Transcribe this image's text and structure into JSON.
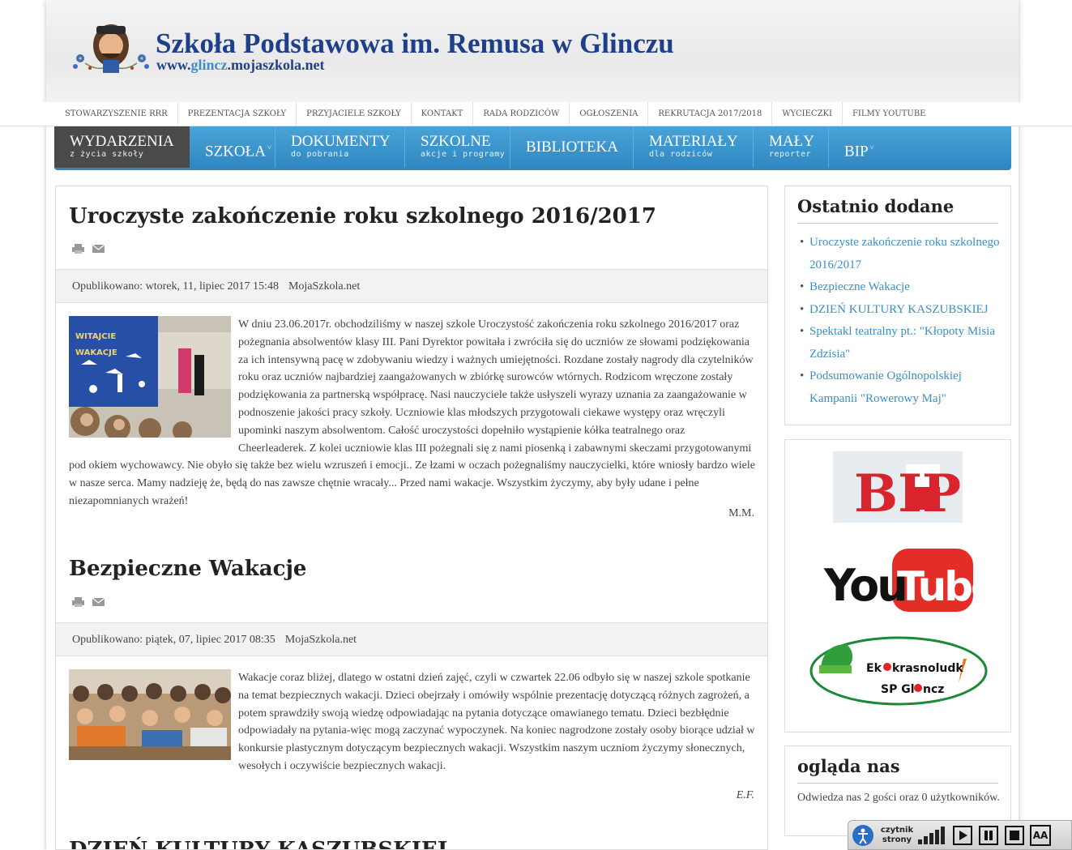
{
  "header": {
    "title": "Szkoła Podstawowa im. Remusa w Glinczu",
    "url_pre": "www.",
    "url_accent": "glincz",
    "url_post": ".mojaszkola.net"
  },
  "top_links": [
    "STOWARZYSZENIE RRR",
    "PREZENTACJA SZKOŁY",
    "PRZYJACIELE SZKOŁY",
    "KONTAKT",
    "RADA RODZICÓW",
    "OGŁOSZENIA",
    "REKRUTACJA 2017/2018",
    "WYCIECZKI",
    "FILMY YOUTUBE"
  ],
  "nav": {
    "wydarzenia": {
      "label": "WYDARZENIA",
      "sub": "z życia szkoły"
    },
    "szkola": {
      "label": "SZKOŁA"
    },
    "dokumenty": {
      "label": "DOKUMENTY",
      "sub": "do pobrania"
    },
    "szkolne": {
      "label": "SZKOLNE",
      "sub": "akcje i programy"
    },
    "biblioteka": {
      "label": "BIBLIOTEKA"
    },
    "materialy": {
      "label": "MATERIAŁY",
      "sub": "dla rodziców"
    },
    "maly": {
      "label": "MAŁY",
      "sub": "reporter"
    },
    "bip": {
      "label": "BIP"
    }
  },
  "articles": [
    {
      "title": "Uroczyste zakończenie roku szkolnego 2016/2017",
      "published": "Opublikowano: wtorek, 11, lipiec 2017 15:48",
      "author": "MojaSzkola.net",
      "body": "W dniu 23.06.2017r. obchodziliśmy w naszej szkole Uroczystość zakończenia roku szkolnego 2016/2017 oraz pożegnania absolwentów klasy III. Pani Dyrektor powitała i zwróciła się do uczniów ze słowami podziękowania za ich intensywną pacę w zdobywaniu wiedzy i ważnych umiejętności. Rozdane zostały nagrody dla czytelników roku oraz uczniów najbardziej zaangażowanych w zbiórkę surowców wtórnych. Rodzicom wręczone zostały podziękowania za partnerską współpracę. Nasi nauczyciele także usłyszeli wyrazy uznania za zaangażowanie w podnoszenie jakości pracy szkoły. Uczniowie klas młodszych przygotowali ciekawe występy oraz wręczyli upominki naszym absolwentom. Całość uroczystości dopełniło wystąpienie kółka teatralnego oraz Cheerleaderek. Z kolei uczniowie klas III pożegnali się z nami piosenką i zabawnymi skeczami przygotowanymi pod okiem wychowawcy. Nie obyło się także bez wielu wzruszeń i emocji.. Ze łzami w oczach pożegnaliśmy nauczycielki, które wniosły bardzo wiele w nasze serca. Mamy nadzieję że, będą do nas zawsze chętnie wracały...  Przed nami wakacje. Wszystkim życzymy, aby były udane i pełne niezapomnianych wrażeń!",
      "signature": "M.M."
    },
    {
      "title": "Bezpieczne Wakacje",
      "published": "Opublikowano: piątek, 07, lipiec 2017 08:35",
      "author": "MojaSzkola.net",
      "body": "Wakacje coraz bliżej, dlatego w ostatni dzień zajęć, czyli w czwartek 22.06 odbyło się w naszej szkole spotkanie na temat bezpiecznych wakacji. Dzieci obejrzały i omówiły wspólnie prezentację dotyczącą różnych zagrożeń, a potem sprawdziły swoją wiedzę odpowiadając na pytania dotyczące omawianego tematu. Dzieci  bezbłędnie odpowiadały na pytania-więc mogą zaczynać wypoczynek.  Na koniec nagrodzone zostały osoby biorące udział w konkursie plastycznym dotyczącym bezpiecznych wakacji. Wszystkim naszym uczniom życzymy słonecznych, wesołych i oczywiście bezpiecznych wakacji.",
      "signature": "E.F."
    },
    {
      "title": "DZIEŃ KULTURY KASZUBSKIEJ"
    }
  ],
  "sidebar": {
    "recent_title": "Ostatnio dodane",
    "recent": [
      "Uroczyste zakończenie roku szkolnego 2016/2017",
      "Bezpieczne Wakacje",
      "DZIEŃ KULTURY KASZUBSKIEJ",
      "Spektakl teatralny pt.: \"Kłopoty Misia Zdzisia\"",
      "Podsumowanie Ogólnopolskiej Kampanii \"Rowerowy Maj\""
    ],
    "banners": {
      "bip": "BIP",
      "youtube_you": "You",
      "youtube_tube": "Tube",
      "eko_line1_a": "Ek",
      "eko_line1_b": "krasnoludk",
      "eko_line2_a": "SP Gl",
      "eko_line2_b": "ncz"
    },
    "visitors_title": "ogląda nas",
    "visitors_text": "Odwiedza nas 2 gości oraz 0 użytkowników."
  },
  "reader": {
    "label1": "czytnik",
    "label2": "strony",
    "text_size": "AA"
  },
  "colors": {
    "nav": "#2e86c1",
    "nav_active": "#4a4a4a",
    "title": "#1e3f8a",
    "link": "#3a8fc7"
  }
}
